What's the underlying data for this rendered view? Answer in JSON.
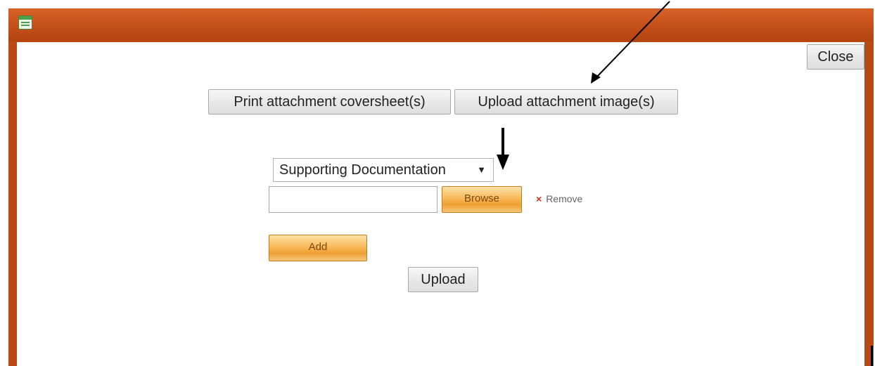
{
  "toolbar": {
    "close_label": "Close",
    "print_label": "Print attachment coversheet(s)",
    "upload_images_label": "Upload attachment image(s)"
  },
  "form": {
    "document_type": {
      "selected": "Supporting Documentation",
      "caret": "▼"
    },
    "file_value": "",
    "browse_label": "Browse",
    "remove_icon": "×",
    "remove_label": "Remove",
    "add_label": "Add",
    "upload_label": "Upload"
  },
  "icons": {
    "window_icon": "window-icon",
    "annotation_arrows": [
      "diagonal-arrow",
      "down-arrow"
    ]
  },
  "colors": {
    "titlebar": "#c4501a",
    "dialog_border": "#ba4a12",
    "orange_button": "#f0a033",
    "remove_x": "#d2301e"
  }
}
